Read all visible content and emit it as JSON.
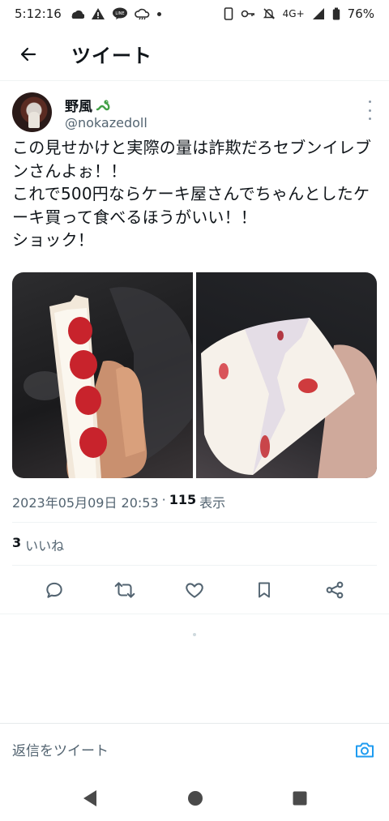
{
  "status_bar": {
    "time": "5:12:16",
    "network": "4G+",
    "battery": "76%",
    "left_icons": [
      "weather-icon",
      "warning-icon",
      "line-icon",
      "cloud-icon",
      "dot-icon"
    ],
    "right_icons": [
      "phone-icon",
      "key-icon",
      "bell-off-icon",
      "signal-icon",
      "battery-icon"
    ]
  },
  "header": {
    "title": "ツイート"
  },
  "tweet": {
    "author_name": "野風",
    "author_handle": "@nokazedoll",
    "text": "この見せかけと実際の量は詐欺だろセブンイレブンさんよぉ！！\nこれで500円ならケーキ屋さんでちゃんとしたケーキ買って食べるほうがいい！！\nショック！",
    "timestamp": "2023年05月09日 20:53",
    "separator": "·",
    "views_count": "115",
    "views_label": "表示",
    "likes_count": "3",
    "likes_label": "いいね",
    "photos": [
      "strawberry-sandwich-photo",
      "bitten-sandwich-photo"
    ]
  },
  "reply": {
    "placeholder": "返信をツイート"
  },
  "colors": {
    "accent": "#1d9bf0",
    "text_primary": "#0f1419",
    "text_secondary": "#536471",
    "divider": "#eff3f4"
  }
}
